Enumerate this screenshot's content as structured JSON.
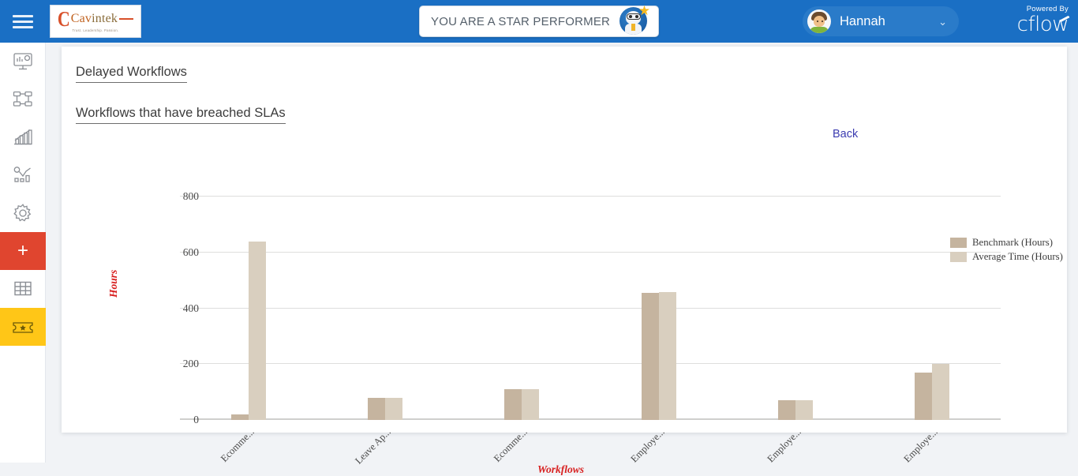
{
  "topbar": {
    "menu_icon": "hamburger-icon",
    "logo": {
      "mark": "C",
      "word_part1": "Cav",
      "word_part2": "intek",
      "tagline": "Trust. Leadership. Passion."
    },
    "star_banner": {
      "text": "YOU ARE A STAR PERFORMER",
      "mascot_icon": "star-performer-mascot-icon",
      "star_icon": "★"
    },
    "user": {
      "name": "Hannah",
      "chevron": "⌄",
      "avatar_icon": "user-avatar-icon"
    },
    "brand": {
      "powered_by": "Powered By",
      "name": "cflow"
    }
  },
  "sidebar": {
    "items": [
      {
        "name": "dashboard-monitor-icon",
        "label": "Dashboard"
      },
      {
        "name": "workflow-diagram-icon",
        "label": "Workflows"
      },
      {
        "name": "bar-chart-growth-icon",
        "label": "Reports"
      },
      {
        "name": "analytics-icon",
        "label": "Analytics"
      },
      {
        "name": "gear-icon",
        "label": "Settings"
      },
      {
        "name": "plus-icon",
        "label": "+"
      },
      {
        "name": "table-grid-icon",
        "label": "Tables"
      },
      {
        "name": "ticket-star-icon",
        "label": "Tickets"
      }
    ]
  },
  "main": {
    "heading": "Delayed Workflows",
    "subheading": "Workflows that have breached SLAs",
    "back_label": "Back"
  },
  "colors": {
    "header_blue": "#1a6fc4",
    "accent_red": "#e0452f",
    "accent_yellow": "#ffc617",
    "benchmark_bar": "#c5b49f",
    "average_bar": "#d9cfbf",
    "axis_label_red": "#d82020",
    "link_blue": "#3b3bb0"
  },
  "chart_data": {
    "type": "bar",
    "title": "Workflows that have breached SLAs",
    "xlabel": "Workflows",
    "ylabel": "Hours",
    "ylim": [
      0,
      800
    ],
    "yticks": [
      0,
      200,
      400,
      600,
      800
    ],
    "grid": true,
    "legend_position": "right",
    "categories": [
      "Ecomme...",
      "Leave Ap...",
      "Ecomme...",
      "Employe...",
      "Employe...",
      "Employe..."
    ],
    "series": [
      {
        "name": "Benchmark (Hours)",
        "color": "#c5b49f",
        "values": [
          20,
          80,
          110,
          455,
          70,
          170
        ]
      },
      {
        "name": "Average Time (Hours)",
        "color": "#d9cfbf",
        "values": [
          640,
          80,
          110,
          458,
          70,
          200
        ]
      }
    ]
  }
}
